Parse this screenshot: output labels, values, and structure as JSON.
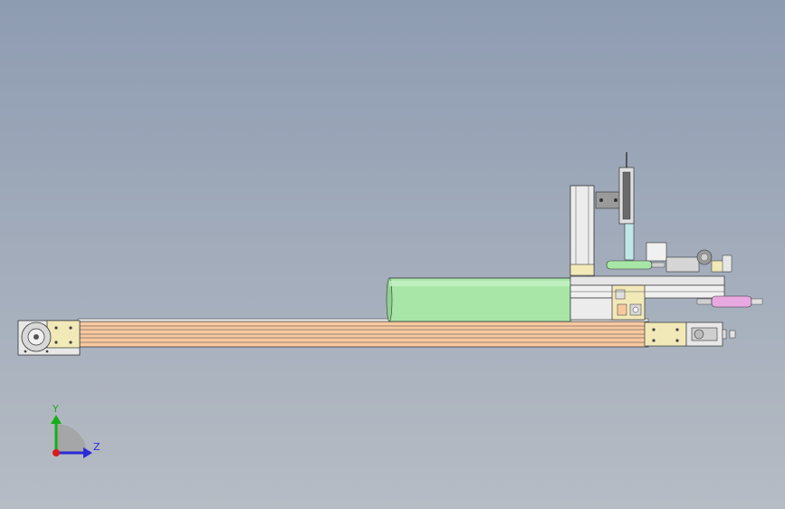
{
  "viewport": {
    "background_top": "#8e9cb2",
    "background_bottom": "#b6bcc4"
  },
  "model": {
    "rail_color": "#f7c9a0",
    "roller_color": "#a8e6a8",
    "bracket_color": "#f2e9b8",
    "cylinder_color": "#e8a8e0"
  },
  "triad": {
    "x_color": "#d81c1c",
    "y_color": "#16b016",
    "z_color": "#2a2ad8",
    "y_label": "Y",
    "z_label": "Z"
  }
}
